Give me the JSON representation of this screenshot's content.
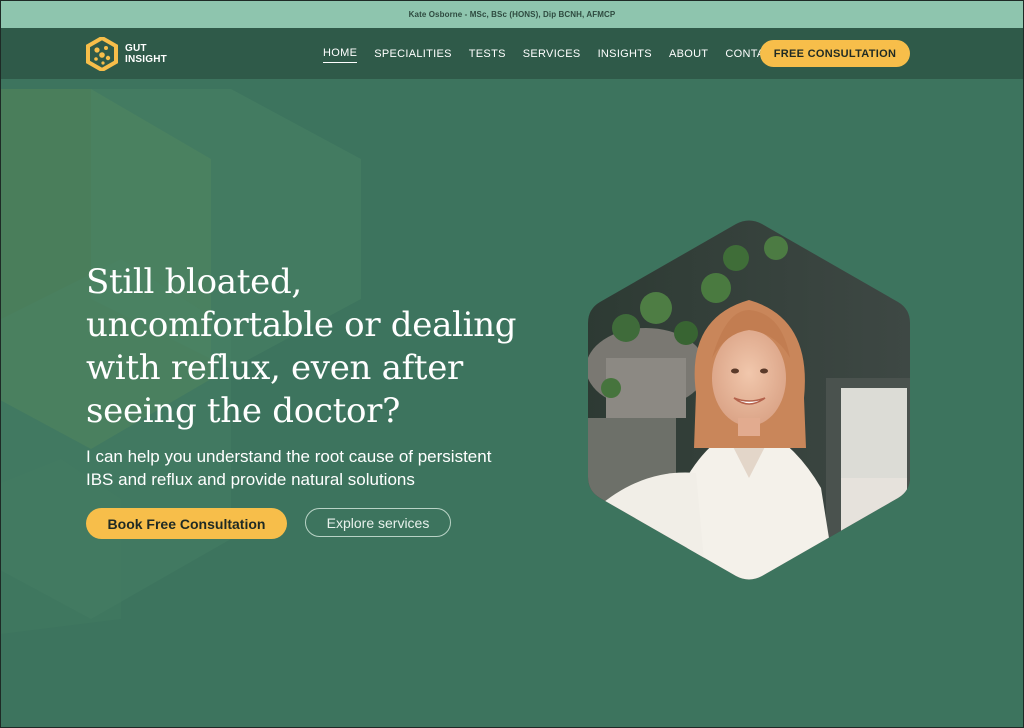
{
  "topbar": {
    "credentials": "Kate Osborne - MSc, BSc (HONS), Dip BCNH, AFMCP"
  },
  "brand": {
    "line1": "GUT",
    "line2": "INSIGHT",
    "icon": "hexagon-logo-icon"
  },
  "nav": {
    "items": [
      {
        "label": "HOME",
        "active": true
      },
      {
        "label": "SPECIALITIES"
      },
      {
        "label": "TESTS"
      },
      {
        "label": "SERVICES"
      },
      {
        "label": "INSIGHTS"
      },
      {
        "label": "ABOUT"
      },
      {
        "label": "CONTACT"
      }
    ],
    "cta": "FREE CONSULTATION"
  },
  "hero": {
    "headline_lines": [
      "Still bloated,",
      "uncomfortable or dealing",
      "with reflux, even after",
      "seeing the doctor?"
    ],
    "subtext_lines": [
      "I can help you understand the root cause of persistent",
      "IBS and reflux and provide natural solutions"
    ],
    "primary_button": "Book Free Consultation",
    "secondary_button": "Explore services"
  },
  "colors": {
    "topbar": "#8ec5ae",
    "navbar": "#2f5a49",
    "hero_bg": "#3d745e",
    "accent": "#f7be4a",
    "text": "#ffffff"
  }
}
